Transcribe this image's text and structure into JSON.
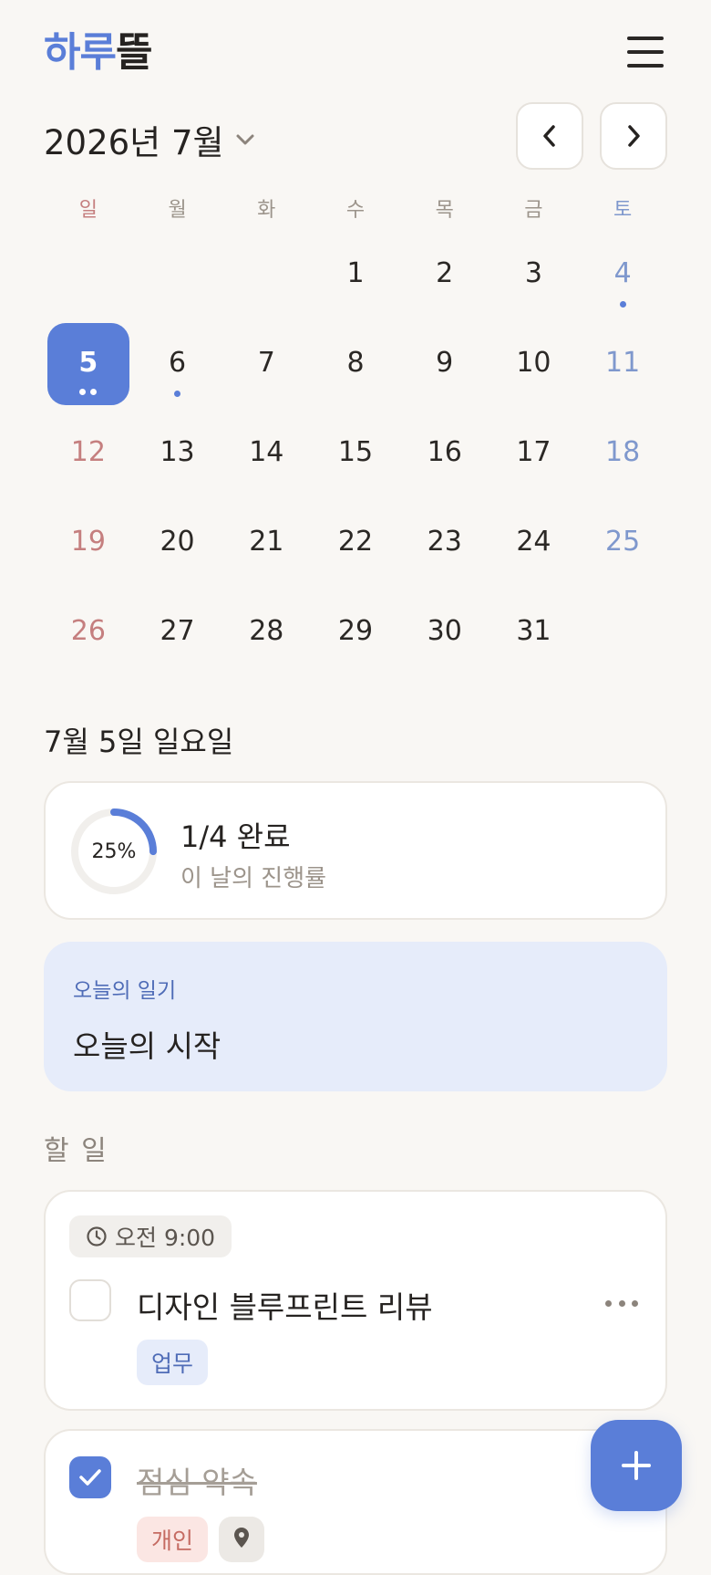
{
  "app": {
    "logo_part1": "하루",
    "logo_part2": "뜰"
  },
  "header": {
    "menu_icon": "hamburger-menu-icon"
  },
  "calendar": {
    "month_label": "2026년 7월",
    "weekdays": [
      "일",
      "월",
      "화",
      "수",
      "목",
      "금",
      "토"
    ],
    "selected_day": 5,
    "days": [
      {
        "d": "",
        "dots": 0
      },
      {
        "d": "",
        "dots": 0
      },
      {
        "d": "",
        "dots": 0
      },
      {
        "d": "1",
        "dots": 0
      },
      {
        "d": "2",
        "dots": 0
      },
      {
        "d": "3",
        "dots": 0
      },
      {
        "d": "4",
        "dots": 1
      },
      {
        "d": "5",
        "dots": 2
      },
      {
        "d": "6",
        "dots": 1
      },
      {
        "d": "7",
        "dots": 0
      },
      {
        "d": "8",
        "dots": 0
      },
      {
        "d": "9",
        "dots": 0
      },
      {
        "d": "10",
        "dots": 0
      },
      {
        "d": "11",
        "dots": 0
      },
      {
        "d": "12",
        "dots": 0
      },
      {
        "d": "13",
        "dots": 0
      },
      {
        "d": "14",
        "dots": 0
      },
      {
        "d": "15",
        "dots": 0
      },
      {
        "d": "16",
        "dots": 0
      },
      {
        "d": "17",
        "dots": 0
      },
      {
        "d": "18",
        "dots": 0
      },
      {
        "d": "19",
        "dots": 0
      },
      {
        "d": "20",
        "dots": 0
      },
      {
        "d": "21",
        "dots": 0
      },
      {
        "d": "22",
        "dots": 0
      },
      {
        "d": "23",
        "dots": 0
      },
      {
        "d": "24",
        "dots": 0
      },
      {
        "d": "25",
        "dots": 0
      },
      {
        "d": "26",
        "dots": 0
      },
      {
        "d": "27",
        "dots": 0
      },
      {
        "d": "28",
        "dots": 0
      },
      {
        "d": "29",
        "dots": 0
      },
      {
        "d": "30",
        "dots": 0
      },
      {
        "d": "31",
        "dots": 0
      },
      {
        "d": "",
        "dots": 0
      }
    ]
  },
  "day": {
    "title": "7월 5일 일요일",
    "progress": {
      "percent_label": "25%",
      "fraction": 0.25,
      "main": "1/4 완료",
      "sub": "이 날의 진행률"
    },
    "diary": {
      "label": "오늘의 일기",
      "text": "오늘의 시작"
    }
  },
  "todos": {
    "section_title": "할 일",
    "items": [
      {
        "time": "오전 9:00",
        "text": "디자인 블루프린트 리뷰",
        "tag": "업무",
        "done": false
      },
      {
        "text": "점심 약속",
        "tag": "개인",
        "done": true
      }
    ]
  },
  "colors": {
    "accent": "#5a7ed8",
    "sunday": "#c57f7f",
    "saturday": "#7f98cd",
    "background": "#f9f7f4"
  }
}
